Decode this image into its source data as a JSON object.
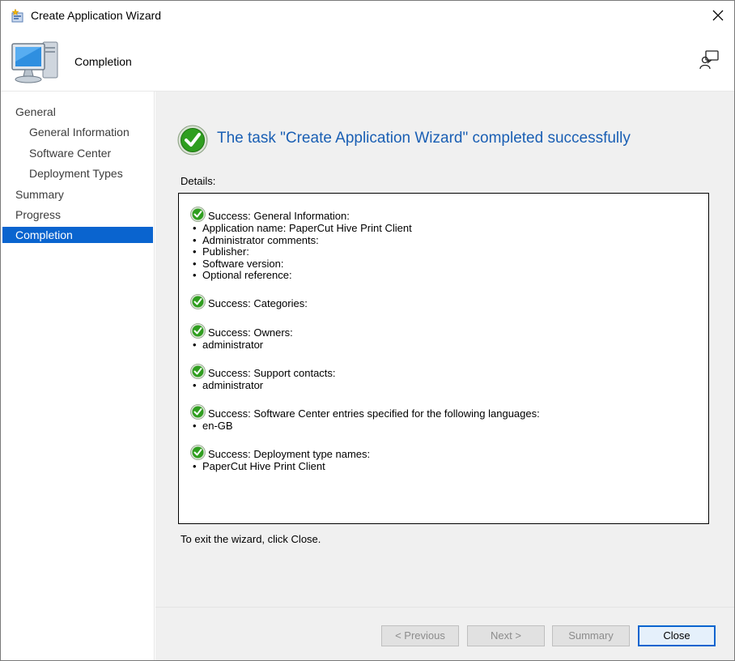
{
  "window": {
    "title": "Create Application Wizard"
  },
  "header": {
    "title": "Completion"
  },
  "nav": {
    "items": [
      {
        "label": "General",
        "level": 1,
        "active": false
      },
      {
        "label": "General Information",
        "level": 2,
        "active": false
      },
      {
        "label": "Software Center",
        "level": 2,
        "active": false
      },
      {
        "label": "Deployment Types",
        "level": 2,
        "active": false
      },
      {
        "label": "Summary",
        "level": 1,
        "active": false
      },
      {
        "label": "Progress",
        "level": 1,
        "active": false
      },
      {
        "label": "Completion",
        "level": 1,
        "active": true
      }
    ]
  },
  "main": {
    "headline": "The task \"Create Application Wizard\" completed successfully",
    "details_label": "Details:",
    "blocks": [
      {
        "heading": "Success: General Information:",
        "bullets": [
          "Application name: PaperCut Hive Print Client",
          "Administrator comments:",
          "Publisher:",
          "Software version:",
          "Optional reference:"
        ]
      },
      {
        "heading": "Success: Categories:",
        "bullets": []
      },
      {
        "heading": "Success: Owners:",
        "bullets": [
          "administrator"
        ]
      },
      {
        "heading": "Success: Support contacts:",
        "bullets": [
          "administrator"
        ]
      },
      {
        "heading": "Success: Software Center entries specified for the following languages:",
        "bullets": [
          "en-GB"
        ]
      },
      {
        "heading": "Success: Deployment type names:",
        "bullets": [
          "PaperCut Hive Print Client"
        ]
      }
    ],
    "exit_text": "To exit the wizard, click Close."
  },
  "buttons": {
    "previous": "< Previous",
    "next": "Next >",
    "summary": "Summary",
    "close": "Close"
  },
  "colors": {
    "accent": "#0a64cf",
    "headline": "#1a5fb4",
    "success_green": "#2f9e1f"
  },
  "icons": {
    "title": "wizard-sparkle-icon",
    "header": "computer-monitor-icon",
    "feedback": "feedback-icon",
    "close": "close-icon",
    "success": "success-check-icon"
  }
}
